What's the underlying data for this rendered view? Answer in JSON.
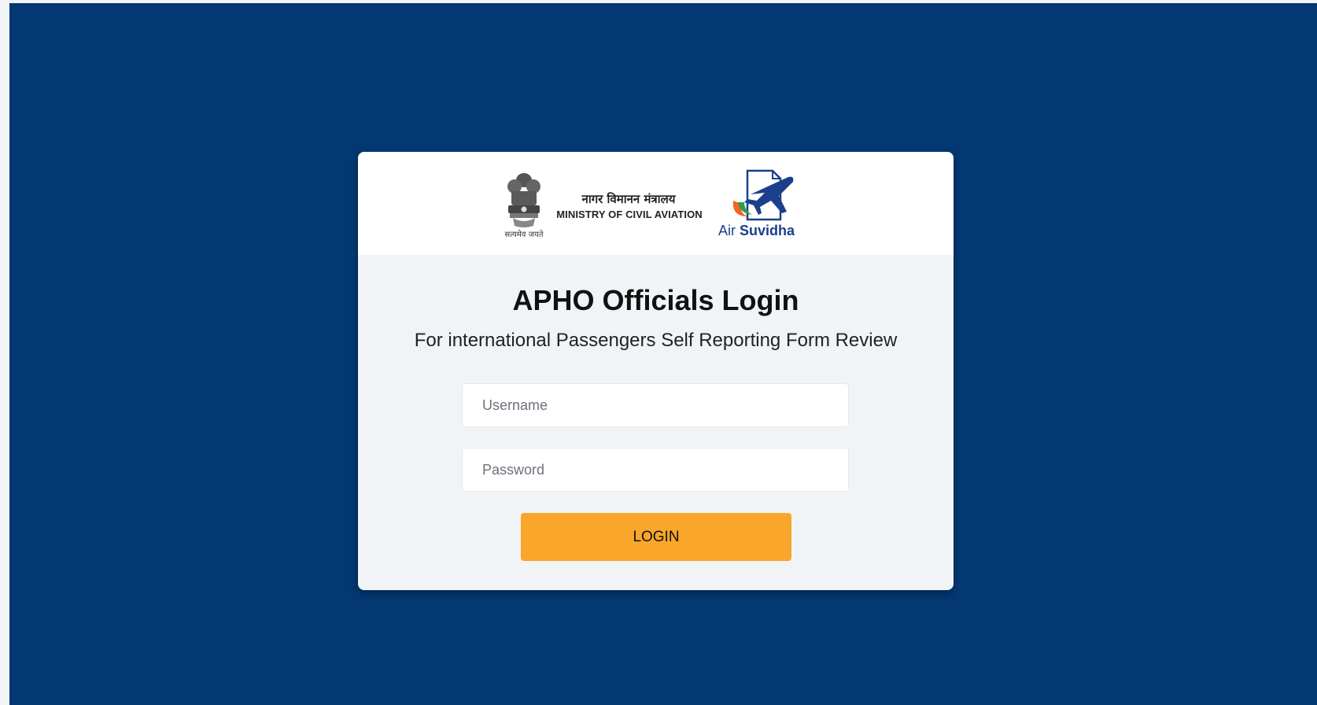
{
  "ministry": {
    "hindi_name": "नागर विमानन मंत्रालय",
    "english_name": "MINISTRY OF CIVIL AVIATION",
    "emblem_motto": "सत्यमेव जयते"
  },
  "brand": {
    "prefix": "Air",
    "name": "Suvidha",
    "icon": "plane-document-icon"
  },
  "login": {
    "title": "APHO Officials Login",
    "subtitle": "For international Passengers Self Reporting Form Review",
    "username_placeholder": "Username",
    "password_placeholder": "Password",
    "button_label": "LOGIN"
  },
  "colors": {
    "background": "#043873",
    "card": "#f1f4f7",
    "header": "#ffffff",
    "button": "#f9a62b",
    "brand_blue": "#1b3f8b",
    "brand_orange": "#f26522",
    "brand_green": "#2e9e49"
  }
}
